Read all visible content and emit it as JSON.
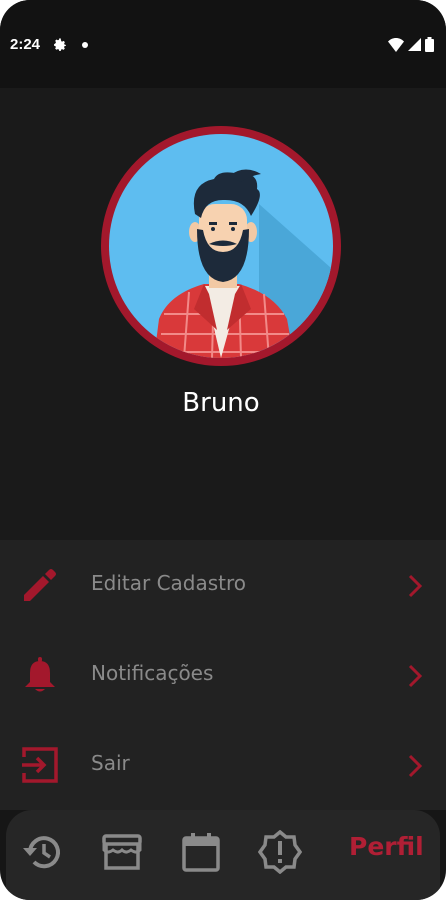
{
  "status_bar": {
    "time": "2:24",
    "icons": [
      "settings-icon",
      "notification-dot-icon",
      "wifi-icon",
      "signal-icon",
      "battery-icon"
    ]
  },
  "profile": {
    "name": "Bruno",
    "avatar": "bearded-man-avatar"
  },
  "menu": {
    "items": [
      {
        "label": "Editar Cadastro",
        "icon": "pencil-icon"
      },
      {
        "label": "Notificações",
        "icon": "bell-icon"
      },
      {
        "label": "Sair",
        "icon": "exit-icon"
      }
    ]
  },
  "bottom_nav": {
    "items": [
      "history-icon",
      "store-icon",
      "calendar-icon",
      "alert-badge-icon"
    ],
    "active_label": "Perfil"
  },
  "colors": {
    "accent": "#a3182c",
    "background": "#161616",
    "menu_background": "#222222",
    "text_muted": "#8a8a8a",
    "avatar_background": "#5ebdf0"
  }
}
